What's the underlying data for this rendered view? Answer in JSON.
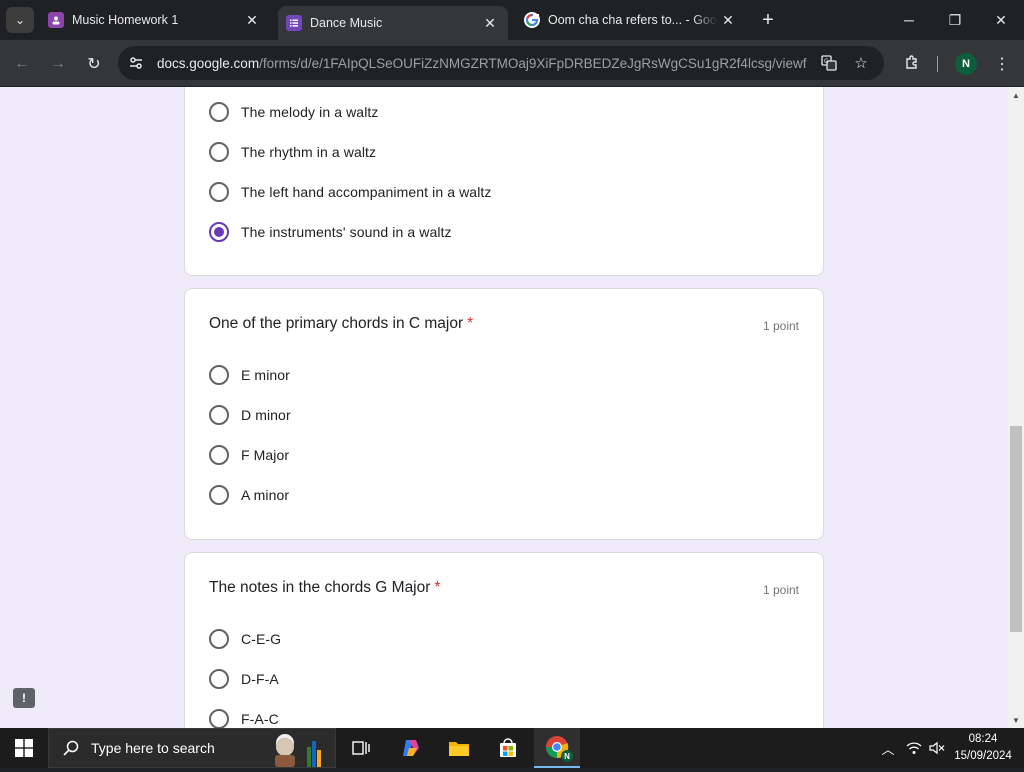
{
  "browser": {
    "tabs": [
      {
        "title": "Music Homework 1",
        "active": false
      },
      {
        "title": "Dance Music",
        "active": true
      },
      {
        "title": "Oom cha cha refers to... - Goog",
        "active": false
      }
    ],
    "url_domain": "docs.google.com",
    "url_path": "/forms/d/e/1FAIpQLSeOUFiZzNMGZRTMOaj9XiFpDRBEDZeJgRsWgCSu1gR2f4lcsg/viewf...",
    "profile_initial": "N"
  },
  "form": {
    "previous_question": {
      "options": [
        {
          "label": "The melody in a waltz",
          "selected": false
        },
        {
          "label": "The rhythm in a waltz",
          "selected": false
        },
        {
          "label": "The left hand accompaniment in a waltz",
          "selected": false
        },
        {
          "label": "The instruments' sound in a waltz",
          "selected": true
        }
      ]
    },
    "question2": {
      "title": "One of the primary chords in C major",
      "required_mark": "*",
      "points": "1 point",
      "options": [
        {
          "label": "E minor",
          "selected": false
        },
        {
          "label": "D minor",
          "selected": false
        },
        {
          "label": "F Major",
          "selected": false
        },
        {
          "label": "A minor",
          "selected": false
        }
      ]
    },
    "question3": {
      "title": "The notes in the chords G Major",
      "required_mark": "*",
      "points": "1 point",
      "options": [
        {
          "label": "C-E-G",
          "selected": false
        },
        {
          "label": "D-F-A",
          "selected": false
        },
        {
          "label": "F-A-C",
          "selected": false
        }
      ]
    },
    "accent_color": "#673ab7",
    "background_color": "#f0ebf8"
  },
  "taskbar": {
    "search_placeholder": "Type here to search",
    "time": "08:24",
    "date": "15/09/2024",
    "chrome_profile_initial": "N"
  }
}
